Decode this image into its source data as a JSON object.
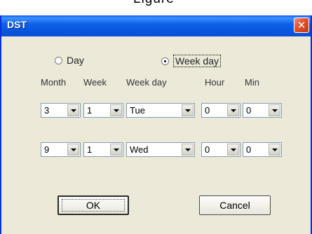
{
  "top_fragment": "Ligure",
  "dialog": {
    "title": "DST",
    "close_icon": "close-icon"
  },
  "mode": {
    "options": [
      {
        "label": "Day",
        "selected": false
      },
      {
        "label": "Week day",
        "selected": true
      }
    ]
  },
  "columns": {
    "month": "Month",
    "week": "Week",
    "week_day": "Week day",
    "hour": "Hour",
    "min": "Min"
  },
  "rows": [
    {
      "month": "3",
      "week": "1",
      "week_day": "Tue",
      "hour": "0",
      "min": "0"
    },
    {
      "month": "9",
      "week": "1",
      "week_day": "Wed",
      "hour": "0",
      "min": "0"
    }
  ],
  "buttons": {
    "ok": "OK",
    "cancel": "Cancel"
  },
  "colors": {
    "title_bar": "#0a58f0",
    "close_button": "#e0502a",
    "dialog_face": "#ece9d8"
  }
}
